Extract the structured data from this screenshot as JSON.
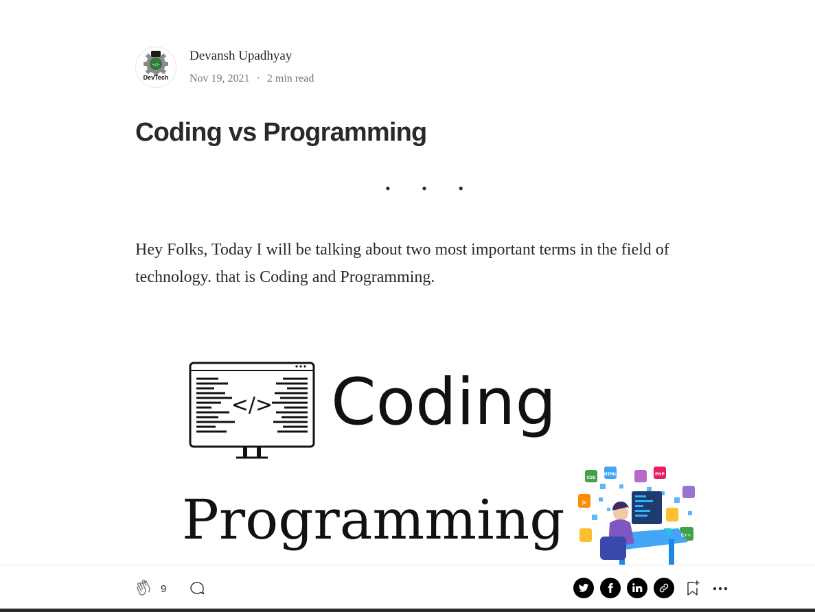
{
  "author": {
    "name": "Devansh Upadhyay",
    "avatar_label": "DevTech",
    "date": "Nov 19, 2021",
    "separator": "·",
    "read_time": "2 min read"
  },
  "article": {
    "title": "Coding vs Programming",
    "section_break": "• • •",
    "body": "Hey Folks, Today I will be talking about two most important terms in the field of technology. that is Coding and Programming.",
    "hero": {
      "word_coding": "Coding",
      "word_programming": "Programming",
      "code_glyph": "</>",
      "badges": [
        "CSS",
        "HTML",
        "PHP",
        "Js",
        "C++"
      ]
    }
  },
  "action_bar": {
    "clap_count": "9",
    "icons": [
      "clap-icon",
      "comment-icon",
      "twitter-icon",
      "facebook-icon",
      "linkedin-icon",
      "copy-link-icon",
      "bookmark-icon",
      "more-icon"
    ]
  },
  "colors": {
    "text": "#292929",
    "muted": "#757575",
    "share_bg": "#000000"
  }
}
